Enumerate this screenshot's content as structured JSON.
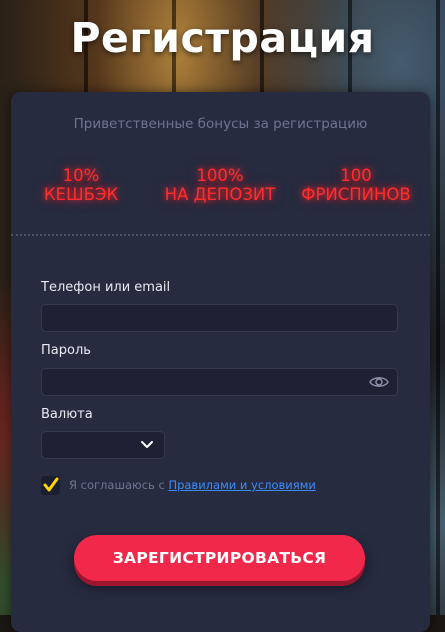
{
  "page": {
    "title": "Регистрация"
  },
  "bonuses": {
    "heading": "Приветственные бонусы за регистрацию",
    "items": [
      {
        "value": "10%",
        "label": "КЕШБЭК"
      },
      {
        "value": "100%",
        "label": "НА ДЕПОЗИТ"
      },
      {
        "value": "100",
        "label": "ФРИСПИНОВ"
      }
    ]
  },
  "form": {
    "phone_label": "Телефон или email",
    "phone_value": "",
    "password_label": "Пароль",
    "password_value": "",
    "currency_label": "Валюта",
    "currency_value": "",
    "agree_text": "Я соглашаюсь с",
    "agree_link": "Правилами и условиями",
    "agree_checked": true,
    "submit_label": "ЗАРЕГИСТРИРОВАТЬСЯ"
  },
  "icons": {
    "password_toggle": "eye-icon",
    "currency_dropdown": "chevron-down-icon",
    "checkbox": "checkmark-icon"
  },
  "colors": {
    "accent": "#f2284a",
    "bonus_text": "#ff2d2d",
    "card_bg": "#262b40",
    "checkbox": "#ffd400",
    "link": "#3d8cff"
  }
}
